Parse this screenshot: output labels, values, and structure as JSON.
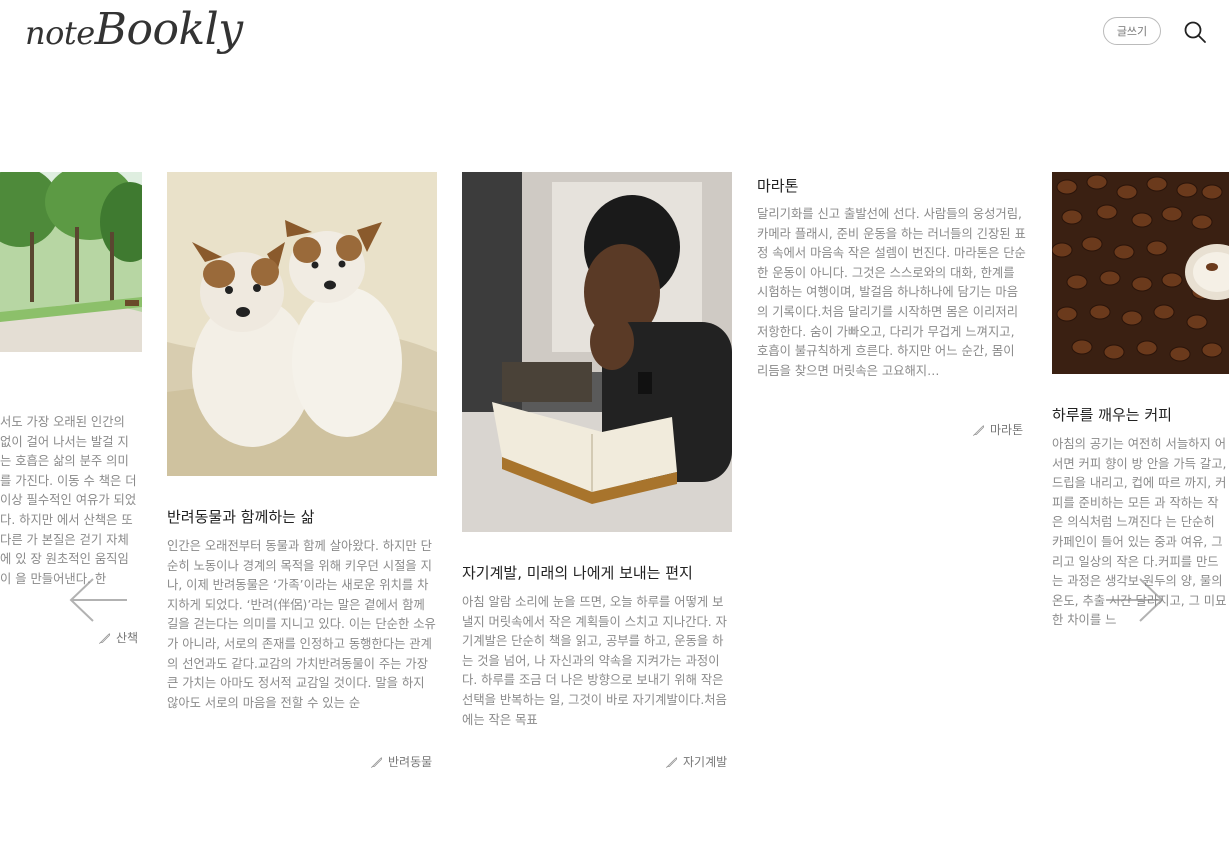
{
  "header": {
    "logo_prefix": "note",
    "logo_main": "Bookly",
    "write_button": "글쓰기"
  },
  "cards": [
    {
      "id": "walk",
      "title": "",
      "excerpt": "서도 가장 오래된 인간의 없이 걸어 나서는 발걸 지는 호흡은 삶의 분주 의미를 가진다. 이동 수 책은 더 이상 필수적인 여유가 되었다. 하지만 에서 산책은 또 다른 가 본질은 걷기 자체에 있 장 원초적인 움직임이 을 만들어낸다. 한",
      "tag": "산책"
    },
    {
      "id": "pets",
      "title": "반려동물과 함께하는 삶",
      "excerpt": "인간은 오래전부터 동물과 함께 살아왔다. 하지만 단순히 노동이나 경계의 목적을 위해 키우던 시절을 지나, 이제 반려동물은 ‘가족’이라는 새로운 위치를 차지하게 되었다. ‘반려(伴侶)’라는 말은 곁에서 함께 길을 걷는다는 의미를 지니고 있다. 이는 단순한 소유가 아니라, 서로의 존재를 인정하고 동행한다는 관계의 선언과도 같다.교감의 가치반려동물이 주는 가장 큰 가치는 아마도 정서적 교감일 것이다. 말을 하지 않아도 서로의 마음을 전할 수 있는 순",
      "tag": "반려동물"
    },
    {
      "id": "self",
      "title": "자기계발, 미래의 나에게 보내는 편지",
      "excerpt": "아침 알람 소리에 눈을 뜨면, 오늘 하루를 어떻게 보낼지 머릿속에서 작은 계획들이 스치고 지나간다. 자기계발은 단순히 책을 읽고, 공부를 하고, 운동을 하는 것을 넘어, 나 자신과의 약속을 지켜가는 과정이다. 하루를 조금 더 나은 방향으로 보내기 위해 작은 선택을 반복하는 일, 그것이 바로 자기계발이다.처음에는 작은 목표",
      "tag": "자기계발"
    },
    {
      "id": "marathon",
      "title": "마라톤",
      "excerpt": "달리기화를 신고 출발선에 선다. 사람들의 웅성거림, 카메라 플래시, 준비 운동을 하는 러너들의 긴장된 표정 속에서 마음속 작은 설렘이 번진다. 마라톤은 단순한 운동이 아니다. 그것은 스스로와의 대화, 한계를 시험하는 여행이며, 발걸음 하나하나에 담기는 마음의 기록이다.처음 달리기를 시작하면 몸은 이리저리 저항한다. 숨이 가빠오고, 다리가 무겁게 느껴지고, 호흡이 불규칙하게 흐른다. 하지만 어느 순간, 몸이 리듬을 찾으면 머릿속은 고요해지…",
      "tag": "마라톤"
    },
    {
      "id": "coffee",
      "title": "하루를 깨우는 커피",
      "excerpt": "아침의 공기는 여전히 서늘하지 어서면 커피 향이 방 안을 가득 갈고, 드립을 내리고, 컵에 따르 까지, 커피를 준비하는 모든 과 작하는 작은 의식처럼 느껴진다 는 단순히 카페인이 들어 있는 중과 여유, 그리고 일상의 작은 다.커피를 만드는 과정은 생각보 원두의 양, 물의 온도, 추출 시간 달라지고, 그 미묘한 차이를 느",
      "tag": ""
    }
  ]
}
